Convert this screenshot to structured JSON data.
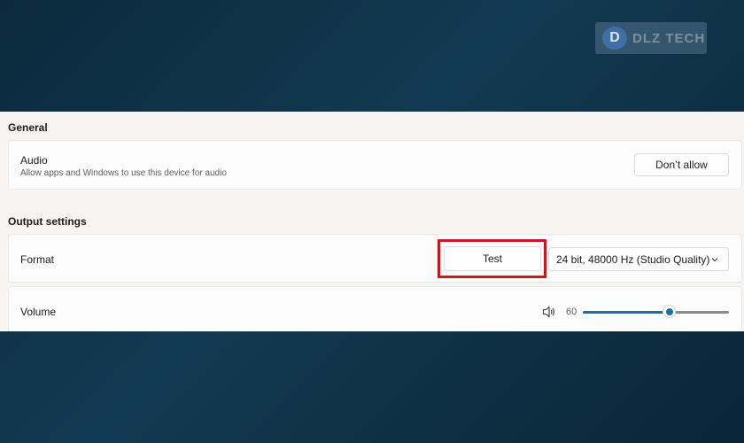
{
  "watermark": {
    "logo_letter": "D",
    "text": "DLZ TECH"
  },
  "general": {
    "title": "General",
    "audio": {
      "title": "Audio",
      "description": "Allow apps and Windows to use this device for audio",
      "button_label": "Don’t allow"
    }
  },
  "output": {
    "title": "Output settings",
    "format": {
      "label": "Format",
      "test_button": "Test",
      "selected": "24 bit, 48000 Hz (Studio Quality)"
    },
    "volume": {
      "label": "Volume",
      "value": "60",
      "level": 0.6
    }
  },
  "icons": {
    "speaker": "speaker-icon",
    "chevron": "chevron-down-icon"
  },
  "colors": {
    "accent": "#1a6fa8",
    "highlight": "#c8171d"
  }
}
